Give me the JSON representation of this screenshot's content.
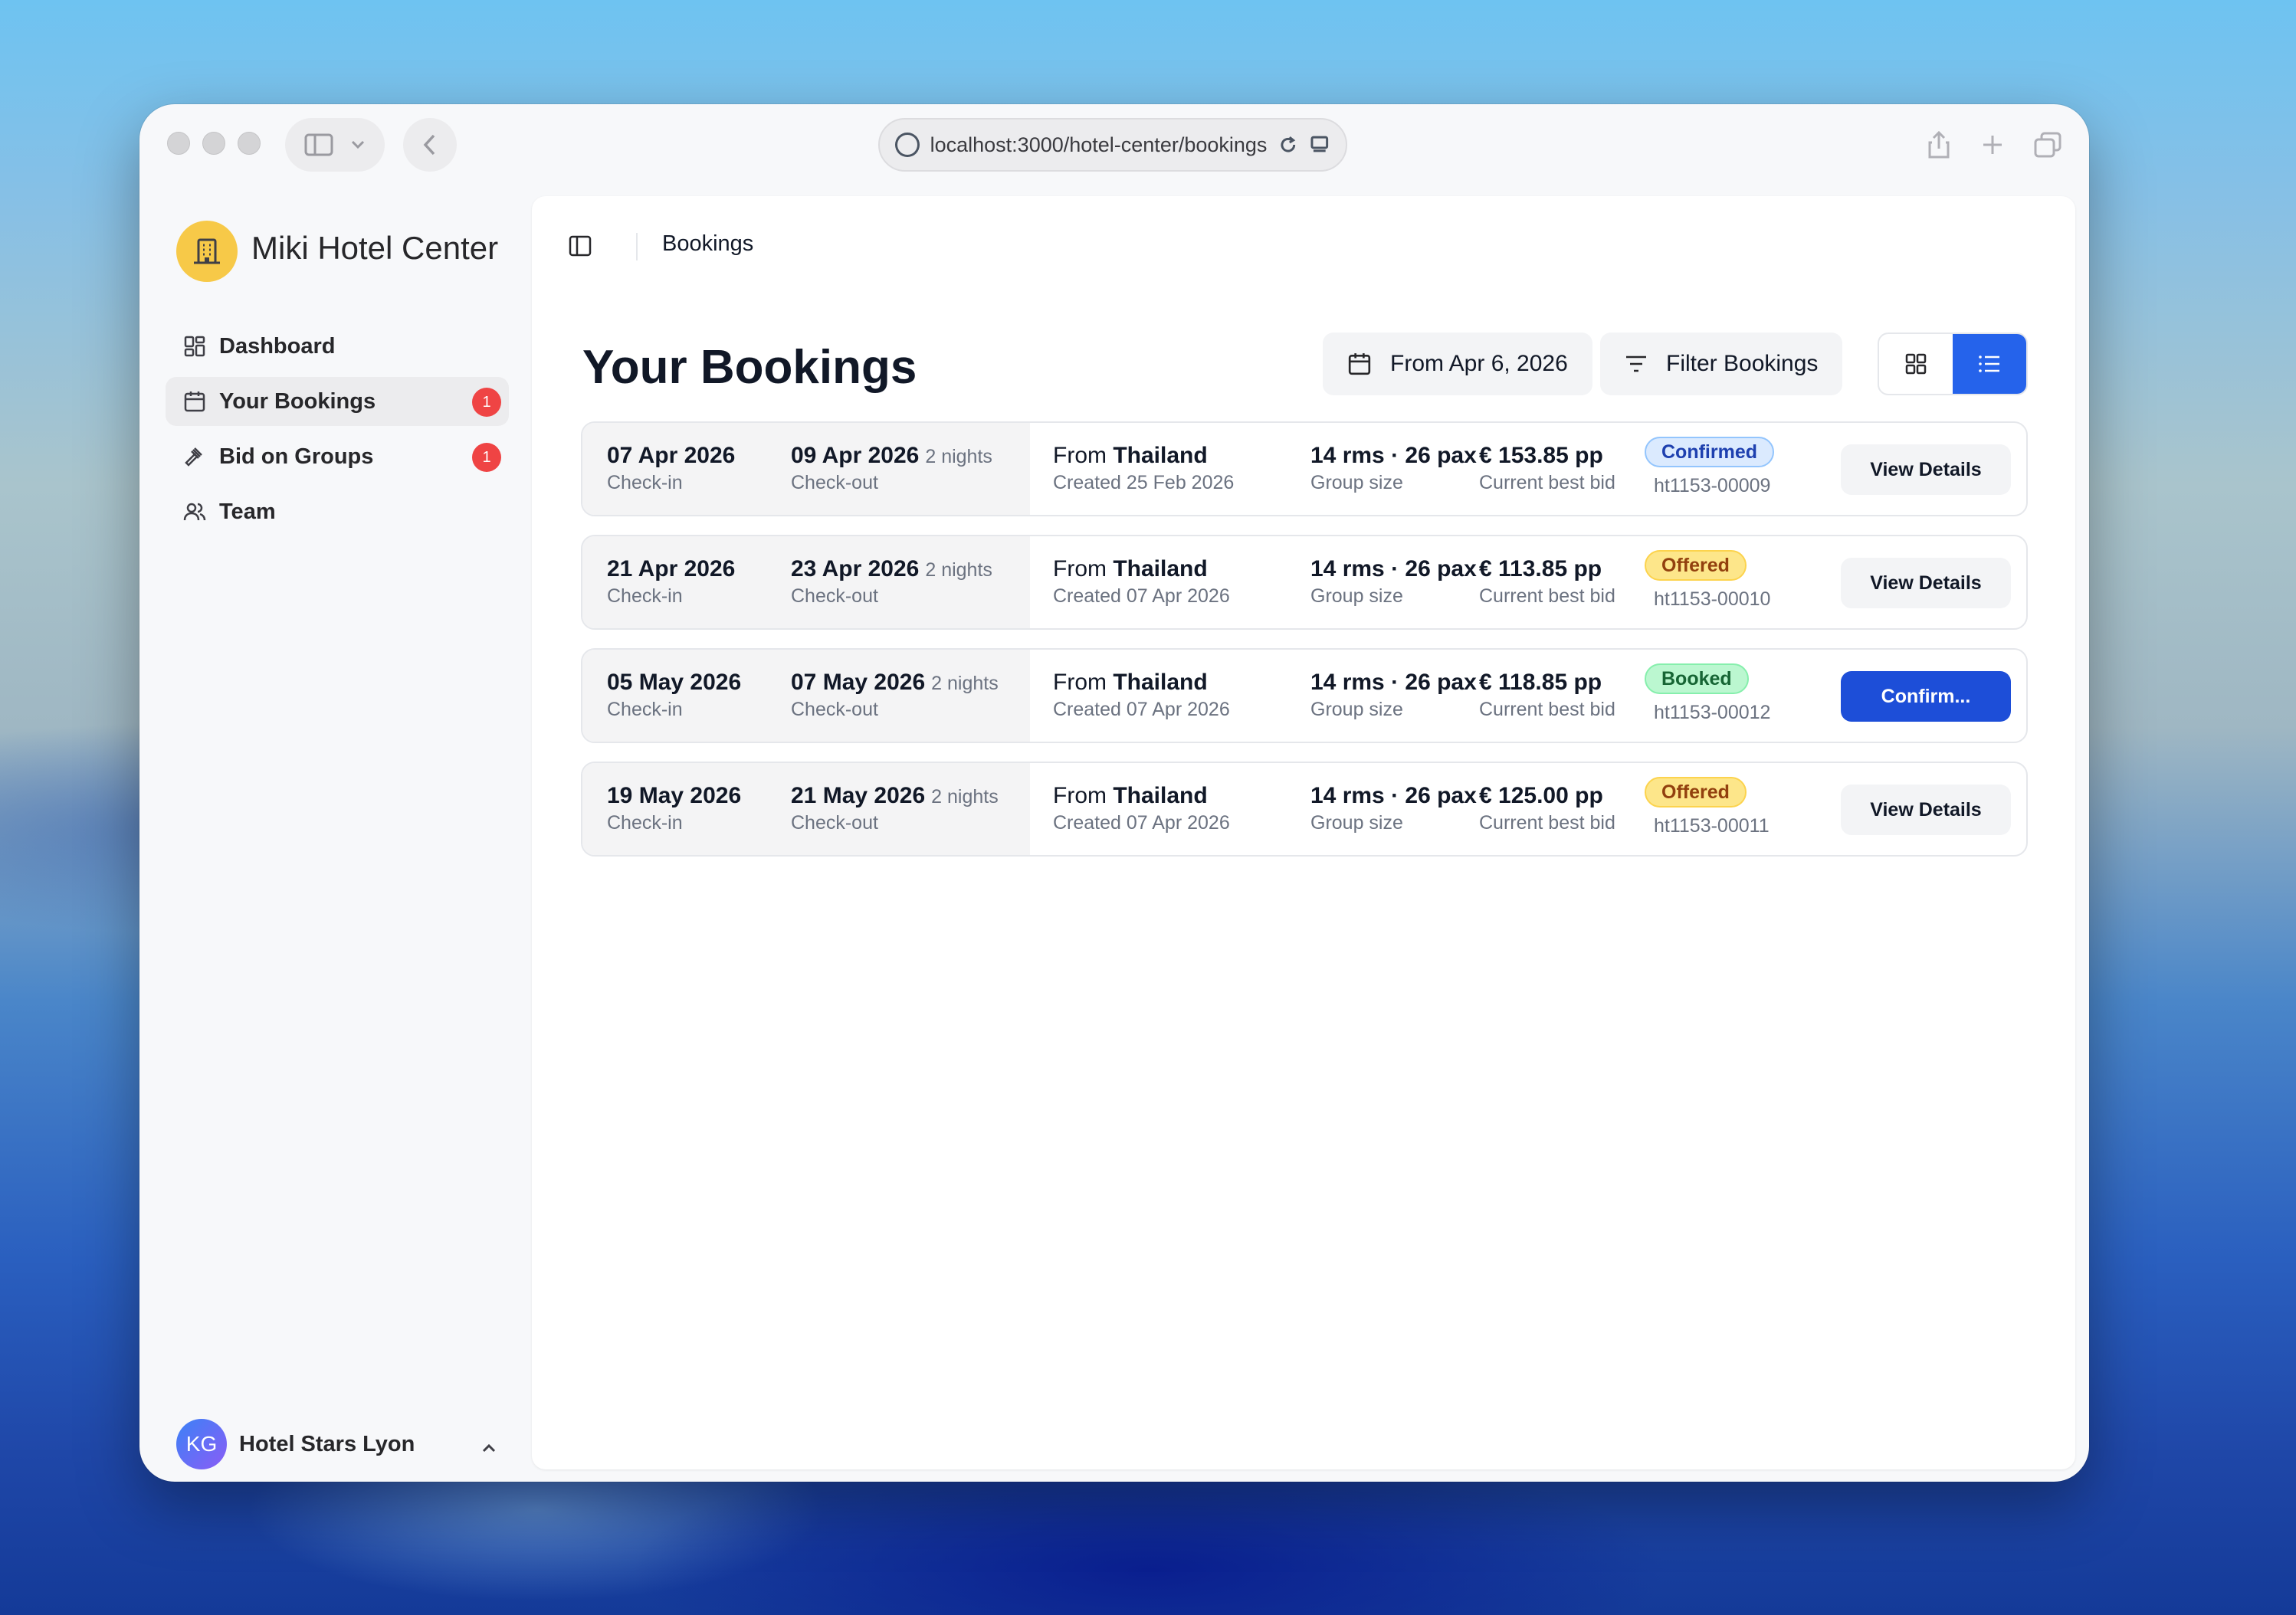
{
  "browser": {
    "url": "localhost:3000/hotel-center/bookings"
  },
  "app": {
    "brand": "Miki Hotel Center"
  },
  "sidebar": {
    "items": [
      {
        "label": "Dashboard",
        "badge": ""
      },
      {
        "label": "Your Bookings",
        "badge": "1"
      },
      {
        "label": "Bid on Groups",
        "badge": "1"
      },
      {
        "label": "Team",
        "badge": ""
      }
    ],
    "user": {
      "initials": "KG",
      "name": "Hotel Stars Lyon"
    }
  },
  "header": {
    "breadcrumb": "Bookings"
  },
  "page": {
    "title": "Your Bookings",
    "date_filter": "From Apr 6, 2026",
    "filter_label": "Filter Bookings"
  },
  "bookings": [
    {
      "checkin": "07 Apr 2026",
      "checkin_label": "Check-in",
      "checkout": "09 Apr 2026",
      "nights": "2 nights",
      "checkout_label": "Check-out",
      "from_prefix": "From",
      "from_country": "Thailand",
      "created": "Created 25 Feb 2026",
      "group": "14 rms · 26 pax",
      "group_label": "Group size",
      "bid": "€ 153.85 pp",
      "bid_label": "Current best bid",
      "status": "Confirmed",
      "ref": "ht1153-00009",
      "action": "View Details"
    },
    {
      "checkin": "21 Apr 2026",
      "checkin_label": "Check-in",
      "checkout": "23 Apr 2026",
      "nights": "2 nights",
      "checkout_label": "Check-out",
      "from_prefix": "From",
      "from_country": "Thailand",
      "created": "Created 07 Apr 2026",
      "group": "14 rms · 26 pax",
      "group_label": "Group size",
      "bid": "€ 113.85 pp",
      "bid_label": "Current best bid",
      "status": "Offered",
      "ref": "ht1153-00010",
      "action": "View Details"
    },
    {
      "checkin": "05 May 2026",
      "checkin_label": "Check-in",
      "checkout": "07 May 2026",
      "nights": "2 nights",
      "checkout_label": "Check-out",
      "from_prefix": "From",
      "from_country": "Thailand",
      "created": "Created 07 Apr 2026",
      "group": "14 rms · 26 pax",
      "group_label": "Group size",
      "bid": "€ 118.85 pp",
      "bid_label": "Current best bid",
      "status": "Booked",
      "ref": "ht1153-00012",
      "action": "Confirm..."
    },
    {
      "checkin": "19 May 2026",
      "checkin_label": "Check-in",
      "checkout": "21 May 2026",
      "nights": "2 nights",
      "checkout_label": "Check-out",
      "from_prefix": "From",
      "from_country": "Thailand",
      "created": "Created 07 Apr 2026",
      "group": "14 rms · 26 pax",
      "group_label": "Group size",
      "bid": "€ 125.00 pp",
      "bid_label": "Current best bid",
      "status": "Offered",
      "ref": "ht1153-00011",
      "action": "View Details"
    }
  ],
  "colors": {
    "accent": "#2563eb",
    "primary_button": "#1d4ed8",
    "badge_red": "#ef4444",
    "logo_yellow": "#f7c948"
  },
  "icons": [
    "globe-icon",
    "reload-icon",
    "reader-icon",
    "share-icon",
    "plus-icon",
    "tabs-icon",
    "sidebar-toggle-icon",
    "back-icon",
    "building-icon",
    "dashboard-icon",
    "calendar-icon",
    "gavel-icon",
    "team-icon",
    "filter-icon",
    "grid-view-icon",
    "list-view-icon",
    "chevron-up-icon"
  ]
}
